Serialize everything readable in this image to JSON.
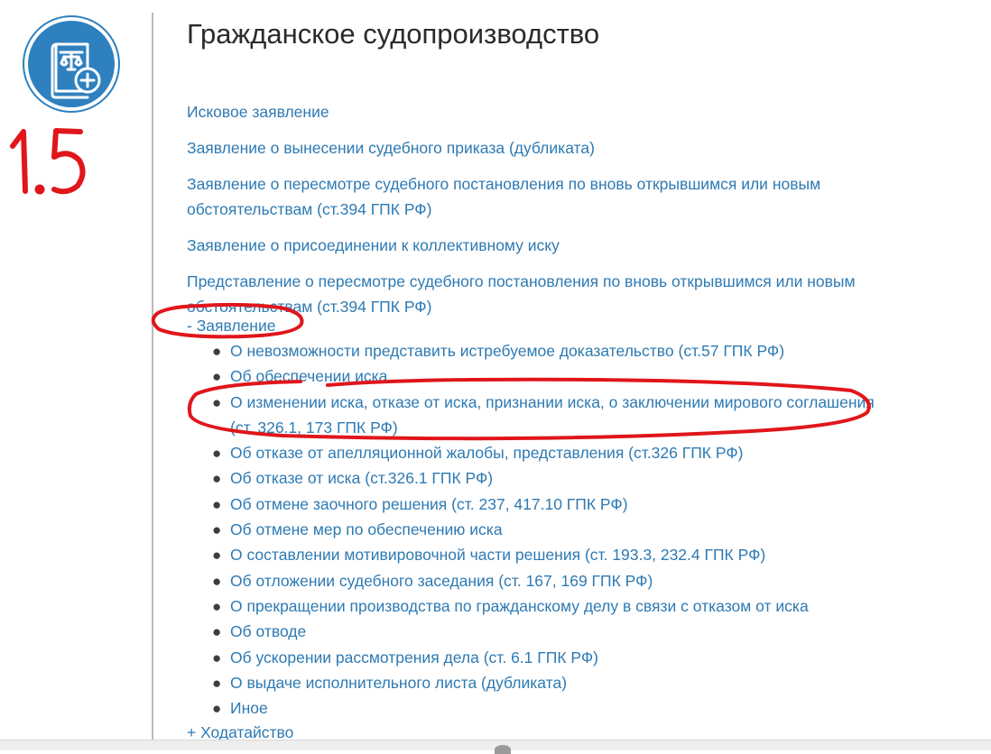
{
  "page": {
    "title": "Гражданское судопроизводство",
    "annotation_label": "1.5"
  },
  "top_links": [
    "Исковое заявление",
    "Заявление о вынесении судебного приказа (дубликата)",
    "Заявление о пересмотре судебного постановления по вновь открывшимся или новым обстоятельствам (ст.394 ГПК РФ)",
    "Заявление о присоединении к коллективному иску",
    "Представление о пересмотре судебного постановления по вновь открывшимся или новым обстоятельствам (ст.394 ГПК РФ)"
  ],
  "section": {
    "toggle": "-  Заявление",
    "items": [
      "О невозможности представить истребуемое доказательство (ст.57 ГПК РФ)",
      "Об обеспечении иска",
      "О изменении иска, отказе от иска, признании иска, о заключении мирового соглашения (ст. 326.1, 173 ГПК РФ)",
      "Об отказе от апелляционной жалобы, представления (ст.326 ГПК РФ)",
      "Об отказе от иска (ст.326.1 ГПК РФ)",
      "Об отмене заочного решения (ст. 237, 417.10 ГПК РФ)",
      "Об отмене мер по обеспечению иска",
      "О составлении мотивировочной части решения (ст. 193.3, 232.4 ГПК РФ)",
      "Об отложении судебного заседания (ст. 167, 169 ГПК РФ)",
      "О прекращении производства по гражданскому делу в связи с отказом от иска",
      "Об отводе",
      "Об ускорении рассмотрения дела (ст. 6.1 ГПК РФ)",
      "О выдаче исполнительного листа (дубликата)",
      "Иное"
    ]
  },
  "collapsed_section": {
    "toggle": "+ Ходатайство"
  },
  "colors": {
    "link": "#2e7ab3",
    "logo": "#2f80bf",
    "annotation": "#e0161b"
  }
}
